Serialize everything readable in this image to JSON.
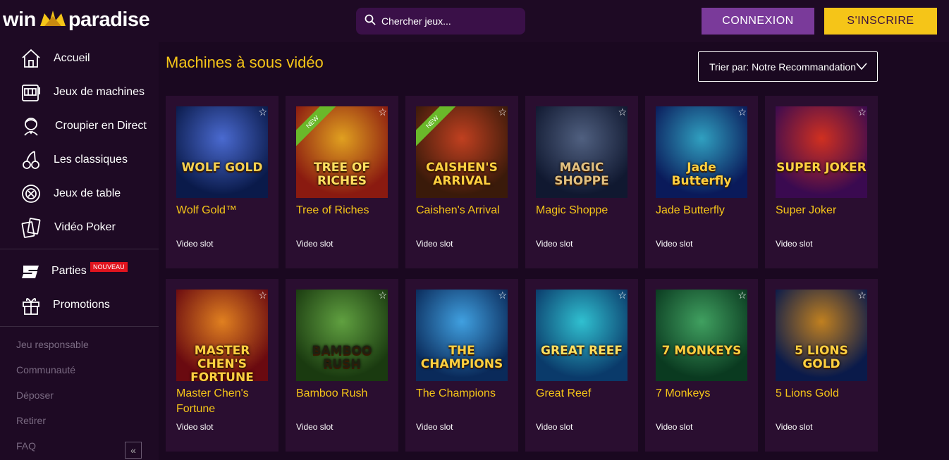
{
  "brand": {
    "part1": "win",
    "part2": "paradise"
  },
  "search": {
    "placeholder": "Chercher jeux..."
  },
  "auth": {
    "login": "CONNEXION",
    "signup": "S'INSCRIRE"
  },
  "sidebar": {
    "items": [
      {
        "label": "Accueil",
        "icon": "home-icon"
      },
      {
        "label": "Jeux de machines",
        "icon": "slot-machine-icon"
      },
      {
        "label": "Croupier en Direct",
        "icon": "dealer-icon"
      },
      {
        "label": "Les classiques",
        "icon": "cherries-icon"
      },
      {
        "label": "Jeux de table",
        "icon": "chip-icon"
      },
      {
        "label": "Vidéo Poker",
        "icon": "cards-icon"
      }
    ],
    "extra": [
      {
        "label": "Parties",
        "icon": "parties-icon",
        "badge": "NOUVEAU"
      },
      {
        "label": "Promotions",
        "icon": "gift-icon"
      }
    ],
    "links": [
      "Jeu responsable",
      "Communauté",
      "Déposer",
      "Retirer",
      "FAQ"
    ],
    "collapse": "«"
  },
  "main": {
    "title": "Machines à sous vidéo",
    "sort_label": "Trier par: Notre Recommandation"
  },
  "games": [
    {
      "title": "Wolf Gold™",
      "type": "Video slot",
      "art": "WOLF GOLD",
      "colors": [
        "#0a1a4a",
        "#4a6ad0"
      ],
      "text_color": "#f5d050"
    },
    {
      "title": "Tree of Riches",
      "type": "Video slot",
      "art": "TREE OF RICHES",
      "colors": [
        "#8a1a10",
        "#e0a020"
      ],
      "text_color": "#ffe060",
      "new": "NEW"
    },
    {
      "title": "Caishen's Arrival",
      "type": "Video slot",
      "art": "CAISHEN'S ARRIVAL",
      "colors": [
        "#3a1a0a",
        "#c04020"
      ],
      "text_color": "#ffd040",
      "new": "NEW"
    },
    {
      "title": "Magic Shoppe",
      "type": "Video slot",
      "art": "MAGIC SHOPPE",
      "colors": [
        "#101830",
        "#506080"
      ],
      "text_color": "#e0c080"
    },
    {
      "title": "Jade Butterfly",
      "type": "Video slot",
      "art": "Jade Butterfly",
      "colors": [
        "#0a1a5a",
        "#30a0c0"
      ],
      "text_color": "#ffd040"
    },
    {
      "title": "Super Joker",
      "type": "Video slot",
      "art": "SUPER JOKER",
      "colors": [
        "#3a0a50",
        "#d03020"
      ],
      "text_color": "#ffd040"
    },
    {
      "title": "Master Chen's Fortune",
      "type": "Video slot",
      "art": "MASTER CHEN'S FORTUNE",
      "colors": [
        "#6a0a10",
        "#e08020"
      ],
      "text_color": "#ffd040"
    },
    {
      "title": "Bamboo Rush",
      "type": "Video slot",
      "art": "BAMBOO RUSH",
      "colors": [
        "#1a3a10",
        "#60a040"
      ],
      "text_color": "#202010"
    },
    {
      "title": "The Champions",
      "type": "Video slot",
      "art": "THE CHAMPIONS",
      "colors": [
        "#0a2a5a",
        "#40a0e0"
      ],
      "text_color": "#ffd040"
    },
    {
      "title": "Great Reef",
      "type": "Video slot",
      "art": "GREAT REEF",
      "colors": [
        "#0a3a6a",
        "#30c0d0"
      ],
      "text_color": "#ffe060"
    },
    {
      "title": "7 Monkeys",
      "type": "Video slot",
      "art": "7 MONKEYS",
      "colors": [
        "#0a3a20",
        "#40a060"
      ],
      "text_color": "#ffd040"
    },
    {
      "title": "5 Lions Gold",
      "type": "Video slot",
      "art": "5 LIONS GOLD",
      "colors": [
        "#0a1a4a",
        "#c08020"
      ],
      "text_color": "#ffd040"
    }
  ]
}
